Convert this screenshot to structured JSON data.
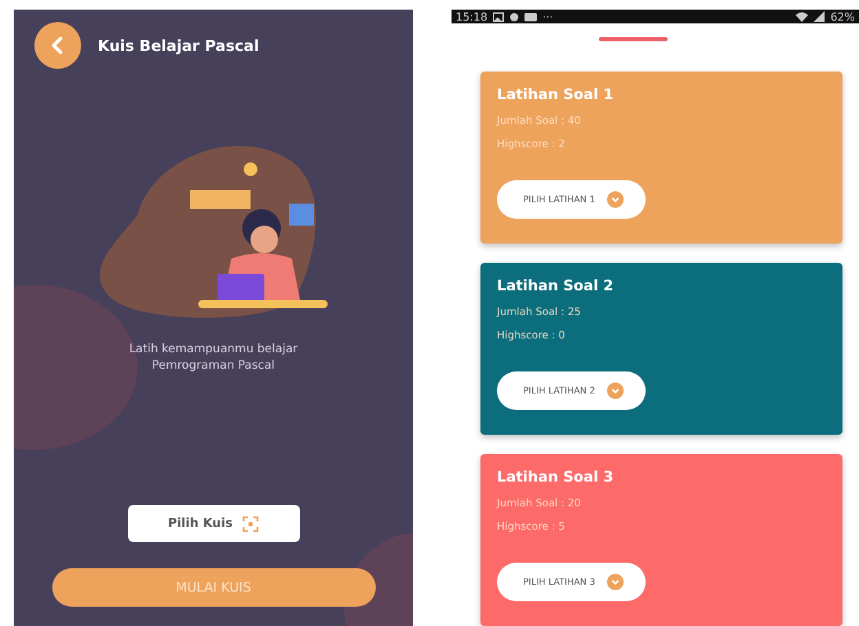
{
  "app_bar": {
    "title": "Kuis Belajar Pascal"
  },
  "description": [
    "Latih kemampuanmu belajar",
    "Pemrograman Pascal"
  ],
  "quiz_picker": {
    "label": "Pilih Kuis"
  },
  "start_button": {
    "label": "MULAI KUIS"
  },
  "status_bar": {
    "time": "15:18",
    "more": "···",
    "battery": "62%"
  },
  "exercises": [
    {
      "title": "Latihan Soal 1",
      "count": "Jumlah Soal : 40",
      "highscore": "Highscore : 2",
      "button": "PILIH LATIHAN 1",
      "color": "#eda35c"
    },
    {
      "title": "Latihan Soal 2",
      "count": "Jumlah Soal : 25",
      "highscore": "Highscore : 0",
      "button": "PILIH LATIHAN 2",
      "color": "#0c6e7c"
    },
    {
      "title": "Latihan Soal 3",
      "count": "Jumlah Soal : 20",
      "highscore": "Highscore : 5",
      "button": "PILIH LATIHAN 3",
      "color": "#fd6a6a"
    }
  ]
}
